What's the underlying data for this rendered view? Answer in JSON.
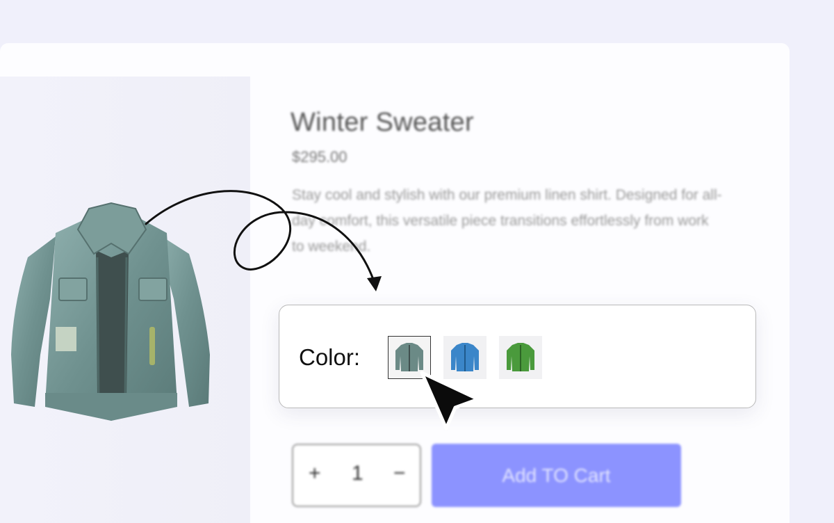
{
  "product": {
    "title": "Winter Sweater",
    "price": "$295.00",
    "description": "Stay cool and stylish with our premium linen shirt. Designed for all-day comfort, this versatile piece transitions effortlessly from work to weekend."
  },
  "color_picker": {
    "label": "Color:",
    "options": [
      {
        "name": "denim",
        "color": "#6b8a86",
        "selected": true
      },
      {
        "name": "blue",
        "color": "#3b86c9",
        "selected": false
      },
      {
        "name": "green",
        "color": "#4a9a3c",
        "selected": false
      }
    ]
  },
  "quantity": {
    "plus": "+",
    "value": "1",
    "minus": "−"
  },
  "cart": {
    "add_label": "Add TO Cart"
  },
  "colors": {
    "accent": "#8c93ff",
    "background": "#f0f0fb"
  }
}
